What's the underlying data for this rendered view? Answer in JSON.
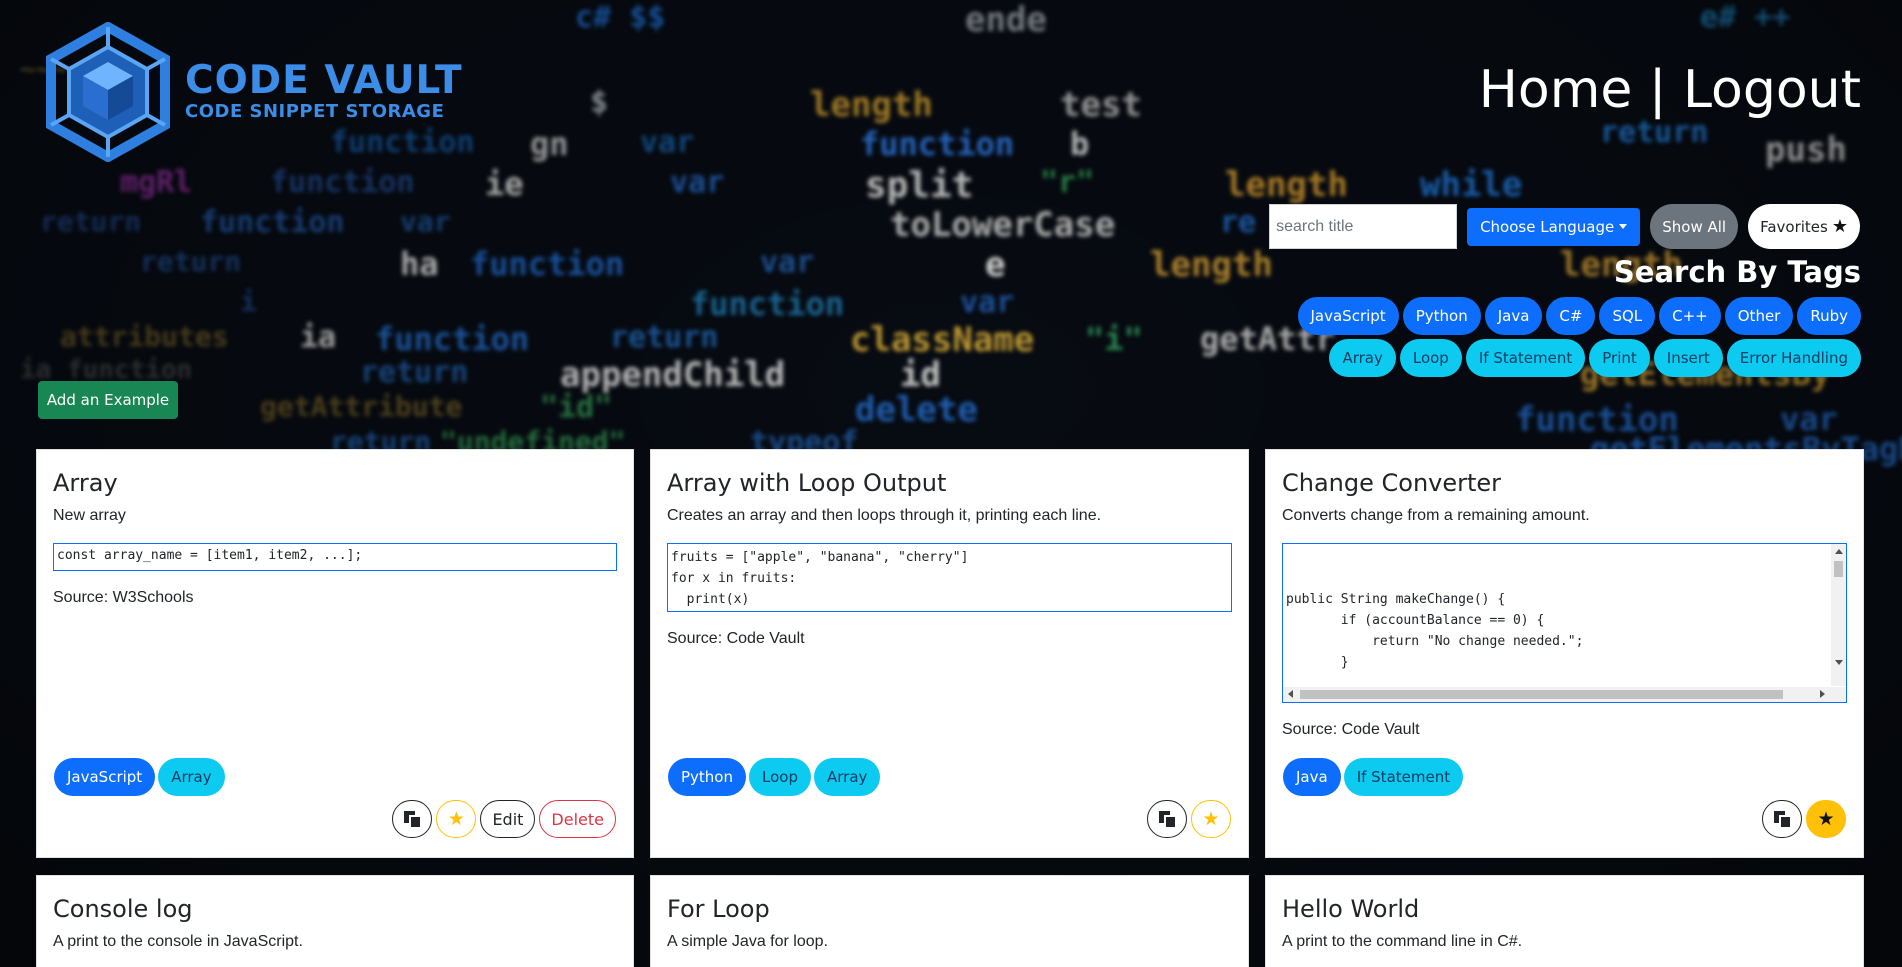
{
  "header": {
    "logo_title": "CODE VAULT",
    "logo_subtitle": "CODE SNIPPET STORAGE",
    "nav_home": "Home",
    "nav_separator": "|",
    "nav_logout": "Logout"
  },
  "toolbar": {
    "search_placeholder": "search title",
    "search_value": "",
    "choose_language_label": "Choose Language",
    "show_all_label": "Show All",
    "favorites_label": "Favorites",
    "favorites_icon": "star-icon"
  },
  "tags_section": {
    "title": "Search By Tags",
    "languages": [
      "JavaScript",
      "Python",
      "Java",
      "C#",
      "SQL",
      "C++",
      "Other",
      "Ruby"
    ],
    "tags": [
      "Array",
      "Loop",
      "If Statement",
      "Print",
      "Insert",
      "Error Handling"
    ]
  },
  "add_example_label": "Add an Example",
  "cards": [
    {
      "title": "Array",
      "description": "New array",
      "code": "const array_name = [item1, item2, ...];",
      "source": "Source: W3Schools",
      "language": "JavaScript",
      "tags": [
        "Array"
      ],
      "favorited": false,
      "edit_label": "Edit",
      "delete_label": "Delete"
    },
    {
      "title": "Array with Loop Output",
      "description": "Creates an array and then loops through it, printing each line.",
      "code": "fruits = [\"apple\", \"banana\", \"cherry\"]\nfor x in fruits:\n  print(x)",
      "source": "Source: Code Vault",
      "language": "Python",
      "tags": [
        "Loop",
        "Array"
      ],
      "favorited": false
    },
    {
      "title": "Change Converter",
      "description": "Converts change from a remaining amount.",
      "code": "public String makeChange() {\n       if (accountBalance == 0) {\n           return \"No change needed.\";\n       }\n\n       String changeAmounts = \"\";",
      "source": "Source: Code Vault",
      "language": "Java",
      "tags": [
        "If Statement"
      ],
      "favorited": true
    },
    {
      "title": "Console log",
      "description": "A print to the console in JavaScript."
    },
    {
      "title": "For Loop",
      "description": "A simple Java for loop."
    },
    {
      "title": "Hello World",
      "description": "A print to the command line in C#."
    }
  ],
  "colors": {
    "primary": "#0d6efd",
    "info": "#0dcaf0",
    "success": "#198754",
    "secondary": "#6c757d",
    "warning": "#ffc107",
    "danger": "#dc3545",
    "logo": "#3b8de8"
  }
}
